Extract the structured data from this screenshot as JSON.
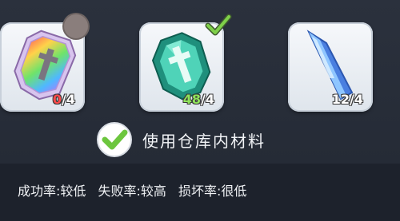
{
  "materials": [
    {
      "name": "rainbow-sword-gem",
      "count": "0",
      "required": "/4",
      "count_color": "#ff4b4b"
    },
    {
      "name": "emerald-sword-gem",
      "count": "48",
      "required": "/4",
      "count_color": "#8fe35a"
    },
    {
      "name": "blue-crystal-shard",
      "count": "12",
      "required": "/4",
      "count_color": "#ffffff"
    }
  ],
  "use_storage": {
    "label": "使用仓库内材料",
    "checked": true
  },
  "rates": {
    "success": "成功率:较低",
    "failure": "失败率:较高",
    "damage": "损坏率:很低"
  },
  "colors": {
    "check_green": "#6cc63e",
    "background": "#232935"
  }
}
